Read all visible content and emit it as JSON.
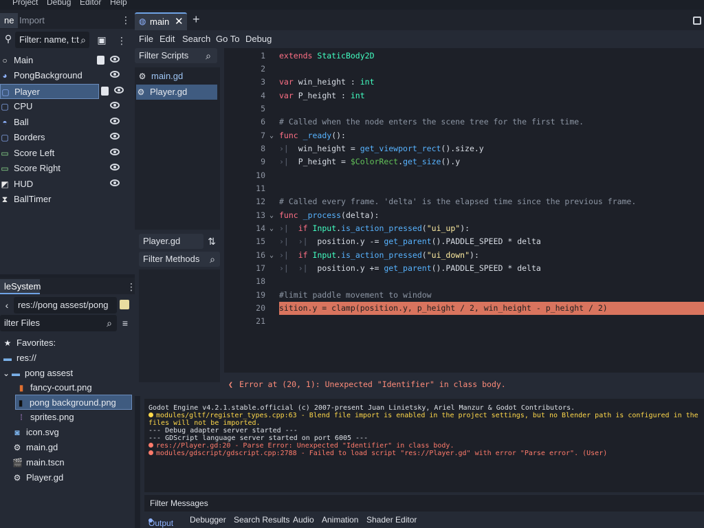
{
  "top_menu": [
    "Project",
    "Debug",
    "Editor",
    "Help"
  ],
  "scene_dock": {
    "tabs": [
      "ne",
      "Import"
    ],
    "filter_placeholder": "Filter: name, t:t",
    "nodes": [
      {
        "label": "Main",
        "icon": "node-icon"
      },
      {
        "label": "PongBackground",
        "icon": "sprite-icon"
      },
      {
        "label": "Player",
        "icon": "static-body-icon"
      },
      {
        "label": "CPU",
        "icon": "static-body-icon"
      },
      {
        "label": "Ball",
        "icon": "character-icon"
      },
      {
        "label": "Borders",
        "icon": "static-body-icon"
      },
      {
        "label": "Score Left",
        "icon": "label-icon"
      },
      {
        "label": "Score Right",
        "icon": "label-icon"
      },
      {
        "label": "HUD",
        "icon": "canvas-layer-icon"
      },
      {
        "label": "BallTimer",
        "icon": "timer-icon"
      }
    ]
  },
  "filesystem": {
    "tab": "leSystem",
    "path": "res://pong assest/pong bac",
    "filter_placeholder": "ilter Files",
    "items": [
      {
        "label": "Favorites:",
        "indent": 0,
        "icon": "star-icon"
      },
      {
        "label": "res://",
        "indent": 0,
        "icon": "folder-icon"
      },
      {
        "label": "pong assest",
        "indent": 1,
        "icon": "folder-icon"
      },
      {
        "label": "fancy-court.png",
        "indent": 2,
        "icon": "image-icon"
      },
      {
        "label": "pong background.png",
        "indent": 2,
        "icon": "image-icon"
      },
      {
        "label": "sprites.png",
        "indent": 2,
        "icon": "image-icon"
      },
      {
        "label": "icon.svg",
        "indent": 1,
        "icon": "svg-icon"
      },
      {
        "label": "main.gd",
        "indent": 1,
        "icon": "gear-icon"
      },
      {
        "label": "main.tscn",
        "indent": 1,
        "icon": "scene-icon"
      },
      {
        "label": "Player.gd",
        "indent": 1,
        "icon": "gear-icon"
      }
    ]
  },
  "editor": {
    "tab_label": "main",
    "menu": [
      "File",
      "Edit",
      "Search",
      "Go To",
      "Debug"
    ],
    "filter_scripts": "Filter Scripts",
    "scripts": [
      "main.gd",
      "Player.gd"
    ],
    "current_script": "Player.gd",
    "filter_methods": "Filter Methods",
    "error_message": "Error at (20, 1): Unexpected \"Identifier\" in class body."
  },
  "output": {
    "lines": [
      {
        "kind": "white",
        "text": "Godot Engine v4.2.1.stable.official (c) 2007-present Juan Linietsky, Ariel Manzur & Godot Contributors."
      },
      {
        "kind": "warn",
        "text": "modules/gltf/register_types.cpp:63 - Blend file import is enabled in the project settings, but no Blender path is configured in the"
      },
      {
        "kind": "warn-cont",
        "text": "files will not be imported."
      },
      {
        "kind": "white",
        "text": "--- Debug adapter server started ---"
      },
      {
        "kind": "white",
        "text": "--- GDScript language server started on port 6005 ---"
      },
      {
        "kind": "err",
        "text": "res://Player.gd:20 - Parse Error: Unexpected \"Identifier\" in class body."
      },
      {
        "kind": "err",
        "text": "modules/gdscript/gdscript.cpp:2788 - Failed to load script \"res://Player.gd\" with error \"Parse error\". (User)"
      }
    ],
    "filter_messages": "Filter Messages",
    "tabs": [
      "Output",
      "Debugger",
      "Search Results",
      "Audio",
      "Animation",
      "Shader Editor"
    ]
  }
}
